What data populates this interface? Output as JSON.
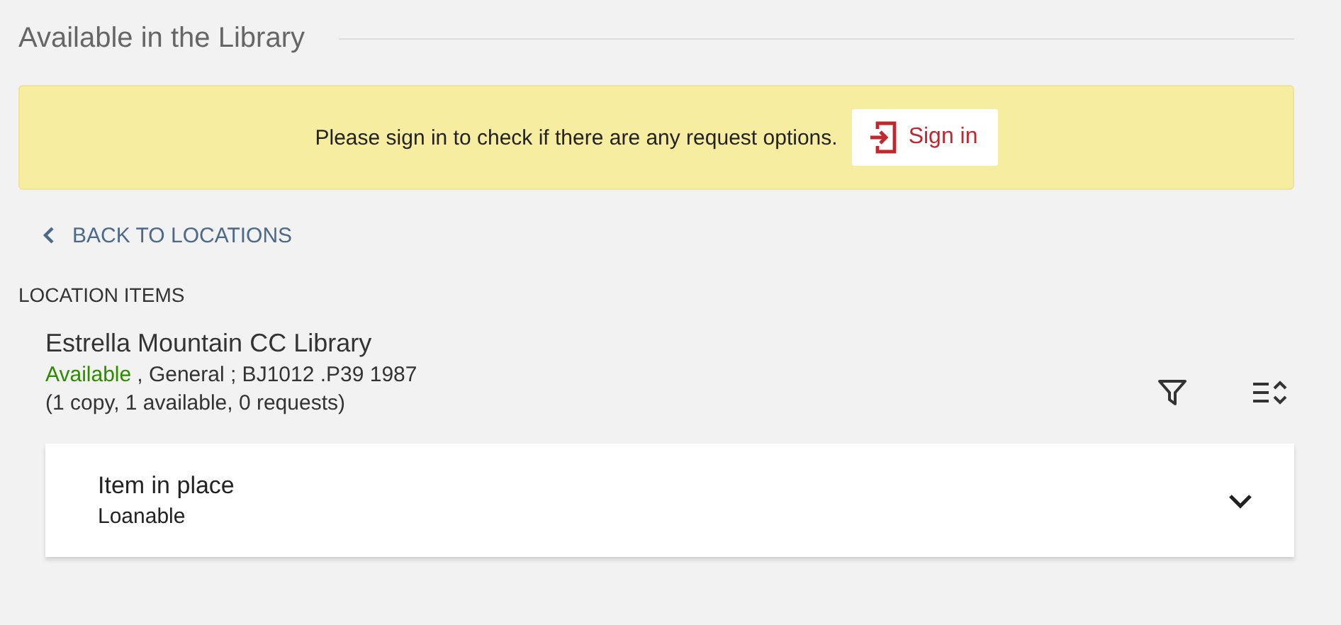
{
  "section": {
    "title": "Available in the Library"
  },
  "banner": {
    "message": "Please sign in to check if there are any request options.",
    "button": "Sign in"
  },
  "back_link": {
    "label": "BACK TO LOCATIONS"
  },
  "location_items": {
    "heading": "LOCATION ITEMS",
    "library": "Estrella Mountain CC Library",
    "status": "Available",
    "details": ", General ; BJ1012 .P39 1987",
    "counts": "(1 copy, 1 available, 0 requests)"
  },
  "items": [
    {
      "title": "Item in place",
      "policy": "Loanable",
      "expanded": false
    }
  ]
}
